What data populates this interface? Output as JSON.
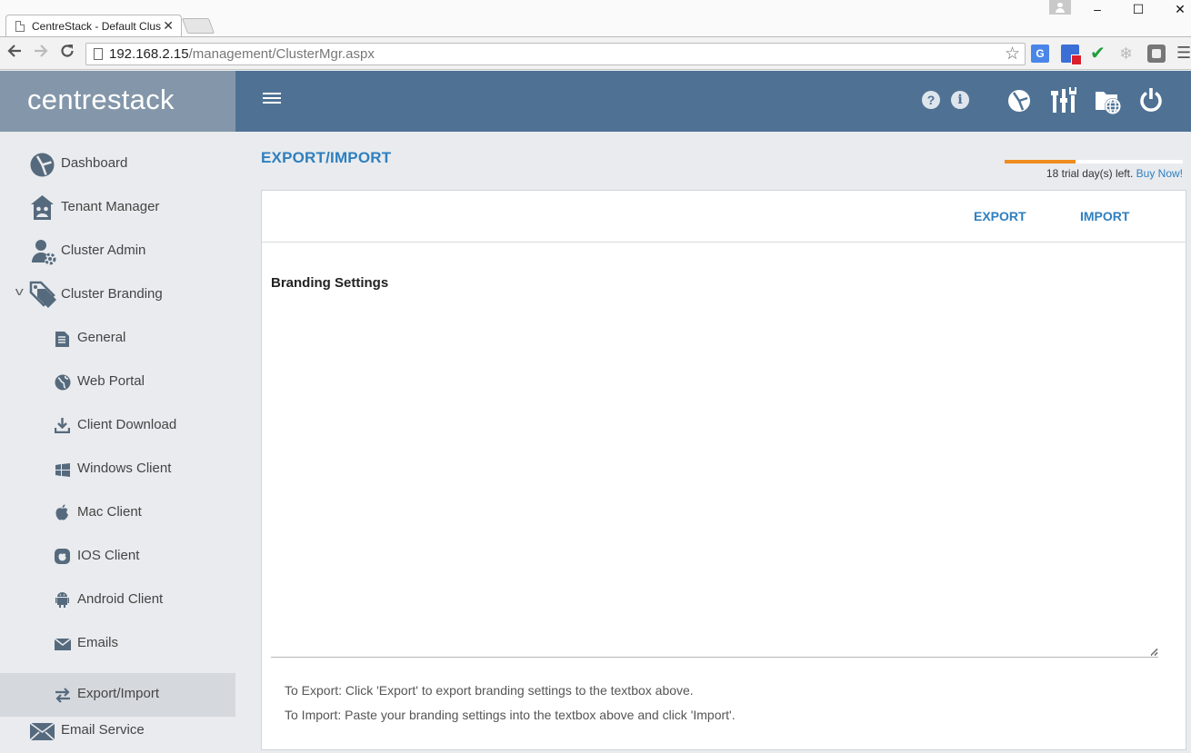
{
  "browser": {
    "tab_title": "CentreStack - Default Clus",
    "tab_close": "✕",
    "url_host": "192.168.2.15",
    "url_path": "/management/ClusterMgr.aspx",
    "window_controls": [
      "–",
      "☐",
      "✕"
    ]
  },
  "header": {
    "logo": "centrestack",
    "icons": [
      "menu-icon",
      "help-icon",
      "info-icon",
      "dashboard-icon",
      "tools-icon",
      "web-portal-icon",
      "power-icon"
    ],
    "color": "#4f7294"
  },
  "sidebar": {
    "items": [
      {
        "label": "Dashboard",
        "icon": "dashboard-icon"
      },
      {
        "label": "Tenant Manager",
        "icon": "tenant-icon"
      },
      {
        "label": "Cluster Admin",
        "icon": "cluster-admin-icon"
      },
      {
        "label": "Cluster Branding",
        "icon": "tag-icon",
        "expanded": true
      },
      {
        "label": "General",
        "icon": "document-icon"
      },
      {
        "label": "Web Portal",
        "icon": "globe-icon"
      },
      {
        "label": "Client Download",
        "icon": "download-icon"
      },
      {
        "label": "Windows Client",
        "icon": "windows-icon"
      },
      {
        "label": "Mac Client",
        "icon": "apple-icon"
      },
      {
        "label": "IOS Client",
        "icon": "ios-icon"
      },
      {
        "label": "Android Client",
        "icon": "android-icon"
      },
      {
        "label": "Emails",
        "icon": "envelope-icon"
      },
      {
        "label": "Export/Import",
        "icon": "swap-icon",
        "active": true
      },
      {
        "label": "Email Service",
        "icon": "mail-icon"
      }
    ]
  },
  "main": {
    "title": "EXPORT/IMPORT",
    "trial": {
      "text": "18 trial day(s) left.",
      "link": "Buy Now!",
      "progress": 0.4
    },
    "actions": {
      "export": "EXPORT",
      "import": "IMPORT"
    },
    "section_label": "Branding Settings",
    "settings_value": "",
    "help": [
      "To Export: Click 'Export' to export branding settings to the textbox above.",
      "To Import: Paste your branding settings into the textbox above and click 'Import'."
    ]
  },
  "colors": {
    "accent": "#2e7fbf",
    "trial_bar": "#f08c1e",
    "sidebar_active": "#d5d9de"
  }
}
